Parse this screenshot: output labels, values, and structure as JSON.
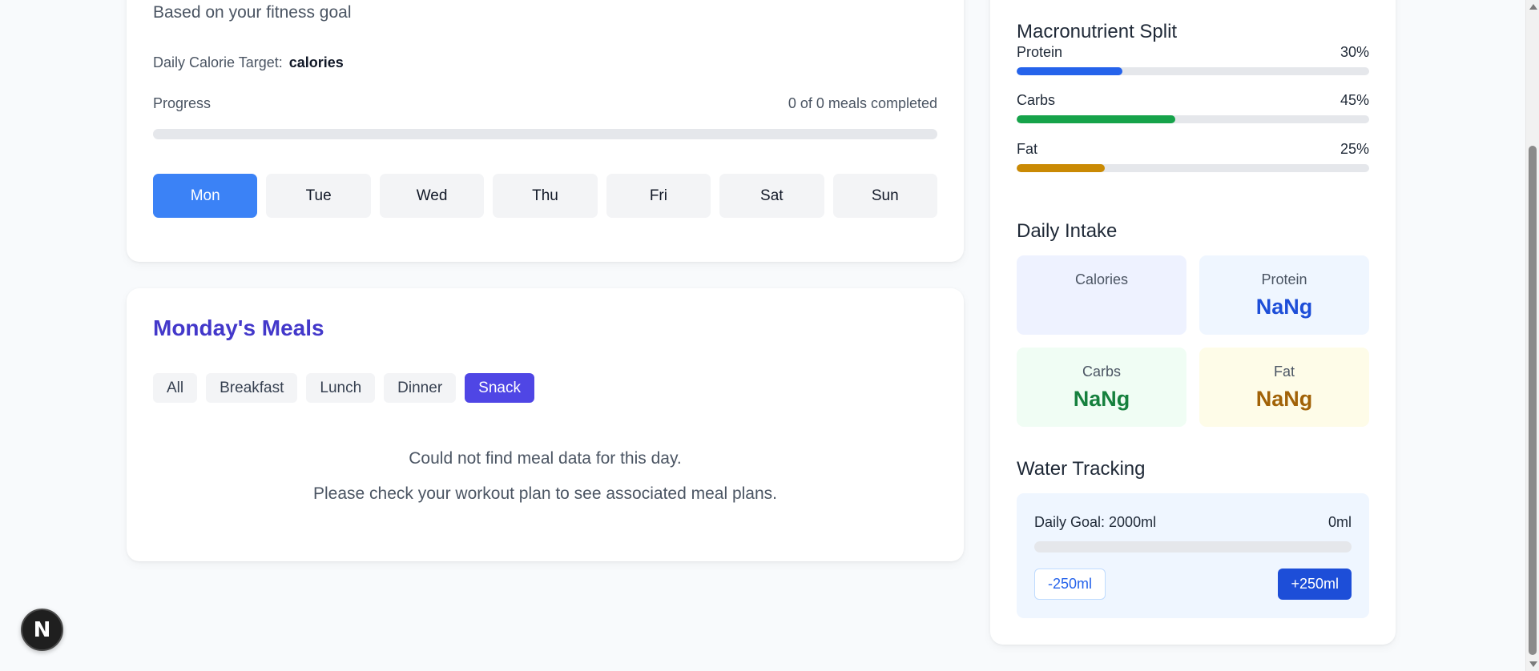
{
  "plan": {
    "subtitle": "Based on your fitness goal",
    "target_label": "Daily Calorie Target:",
    "target_value": "calories",
    "progress_label": "Progress",
    "progress_status": "0 of 0 meals completed",
    "progress_fraction": 0,
    "days": [
      {
        "label": "Mon",
        "active": true
      },
      {
        "label": "Tue",
        "active": false
      },
      {
        "label": "Wed",
        "active": false
      },
      {
        "label": "Thu",
        "active": false
      },
      {
        "label": "Fri",
        "active": false
      },
      {
        "label": "Sat",
        "active": false
      },
      {
        "label": "Sun",
        "active": false
      }
    ]
  },
  "meals": {
    "title": "Monday's Meals",
    "filters": [
      {
        "label": "All",
        "active": false
      },
      {
        "label": "Breakfast",
        "active": false
      },
      {
        "label": "Lunch",
        "active": false
      },
      {
        "label": "Dinner",
        "active": false
      },
      {
        "label": "Snack",
        "active": true
      }
    ],
    "empty_line_1": "Could not find meal data for this day.",
    "empty_line_2": "Please check your workout plan to see associated meal plans."
  },
  "macros": {
    "title": "Macronutrient Split",
    "items": [
      {
        "label": "Protein",
        "percent_text": "30%",
        "percent": 30,
        "color": "#2563eb"
      },
      {
        "label": "Carbs",
        "percent_text": "45%",
        "percent": 45,
        "color": "#16a34a"
      },
      {
        "label": "Fat",
        "percent_text": "25%",
        "percent": 25,
        "color": "#ca8a04"
      }
    ]
  },
  "intake": {
    "title": "Daily Intake",
    "tiles": [
      {
        "label": "Calories",
        "value": "",
        "bg": "#eef2ff",
        "color": "#4338ca"
      },
      {
        "label": "Protein",
        "value": "NaNg",
        "bg": "#eff6ff",
        "color": "#1d4ed8"
      },
      {
        "label": "Carbs",
        "value": "NaNg",
        "bg": "#f0fdf4",
        "color": "#15803d"
      },
      {
        "label": "Fat",
        "value": "NaNg",
        "bg": "#fefce8",
        "color": "#a16207"
      }
    ]
  },
  "water": {
    "title": "Water Tracking",
    "goal_label": "Daily Goal: 2000ml",
    "current": "0ml",
    "fraction": 0,
    "minus_label": "-250ml",
    "plus_label": "+250ml"
  },
  "badge": {
    "letter": "N",
    "icon": "nextjs-logo-icon"
  }
}
